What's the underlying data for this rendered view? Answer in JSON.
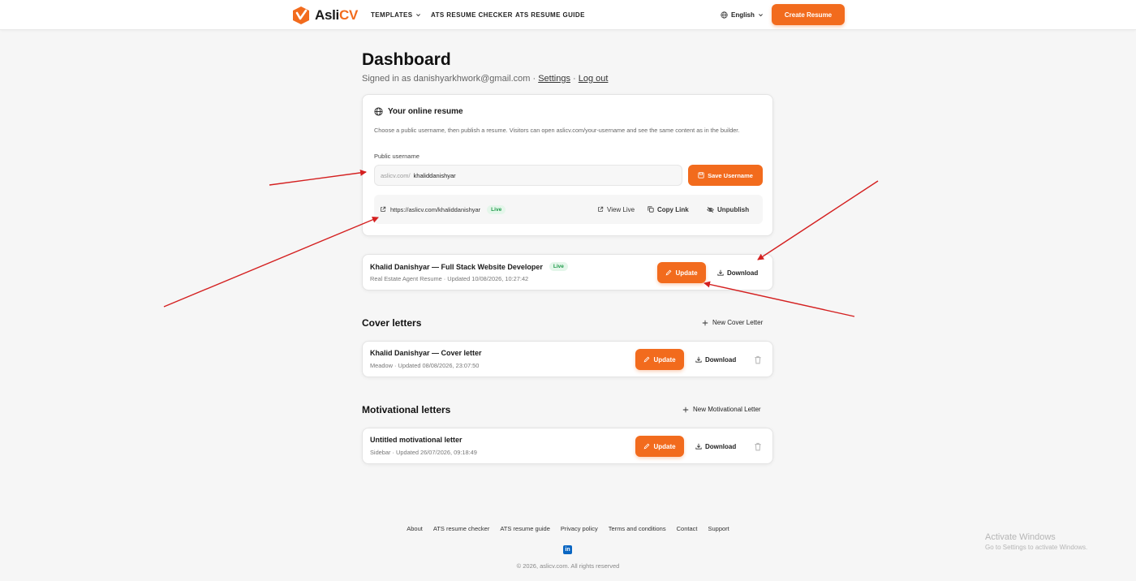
{
  "header": {
    "logo": {
      "part1": "Asli",
      "part2": "CV"
    },
    "nav": {
      "templates": "TEMPLATES",
      "checker": "ATS RESUME CHECKER",
      "guide": "ATS RESUME GUIDE"
    },
    "language": "English",
    "create_button": "Create Resume"
  },
  "page": {
    "title": "Dashboard",
    "signed_in_prefix": "Signed in as danishyarkhwork@gmail.com · ",
    "settings": "Settings",
    "separator": " · ",
    "logout": "Log out"
  },
  "online_resume": {
    "title": "Your online resume",
    "description": "Choose a public username, then publish a resume. Visitors can open aslicv.com/your-username and see the same content as in the builder.",
    "username_label": "Public username",
    "prefix": "aslicv.com/",
    "username_value": "khaliddanishyar",
    "save_button": "Save Username",
    "public_url": "https://aslicv.com/khaliddanishyar",
    "status": "Live",
    "view_live": "View Live",
    "copy_link": "Copy Link",
    "unpublish": "Unpublish"
  },
  "resume": {
    "title": "Khalid Danishyar — Full Stack Website Developer",
    "status": "Live",
    "subtitle": "Real Estate Agent Resume · Updated 10/08/2026, 10:27:42",
    "update": "Update",
    "download": "Download"
  },
  "cover_letters": {
    "title": "Cover letters",
    "new_button": "New Cover Letter",
    "items": [
      {
        "title": "Khalid Danishyar — Cover letter",
        "subtitle": "Meadow · Updated 08/08/2026, 23:07:50",
        "update": "Update",
        "download": "Download"
      }
    ]
  },
  "motivational_letters": {
    "title": "Motivational letters",
    "new_button": "New Motivational Letter",
    "items": [
      {
        "title": "Untitled motivational letter",
        "subtitle": "Sidebar · Updated 26/07/2026, 09:18:49",
        "update": "Update",
        "download": "Download"
      }
    ]
  },
  "footer": {
    "links": [
      "About",
      "ATS resume checker",
      "ATS resume guide",
      "Privacy policy",
      "Terms and conditions",
      "Contact",
      "Support"
    ],
    "linkedin": "in",
    "copyright": "© 2026, aslicv.com. All rights reserved"
  },
  "watermark": {
    "line1": "Activate Windows",
    "line2": "Go to Settings to activate Windows."
  },
  "colors": {
    "accent": "#f26b1d",
    "live_bg": "#e4f6ea",
    "live_text": "#1f9a4a",
    "annotation_arrow": "#d42020",
    "linkedin": "#0a66c2"
  }
}
